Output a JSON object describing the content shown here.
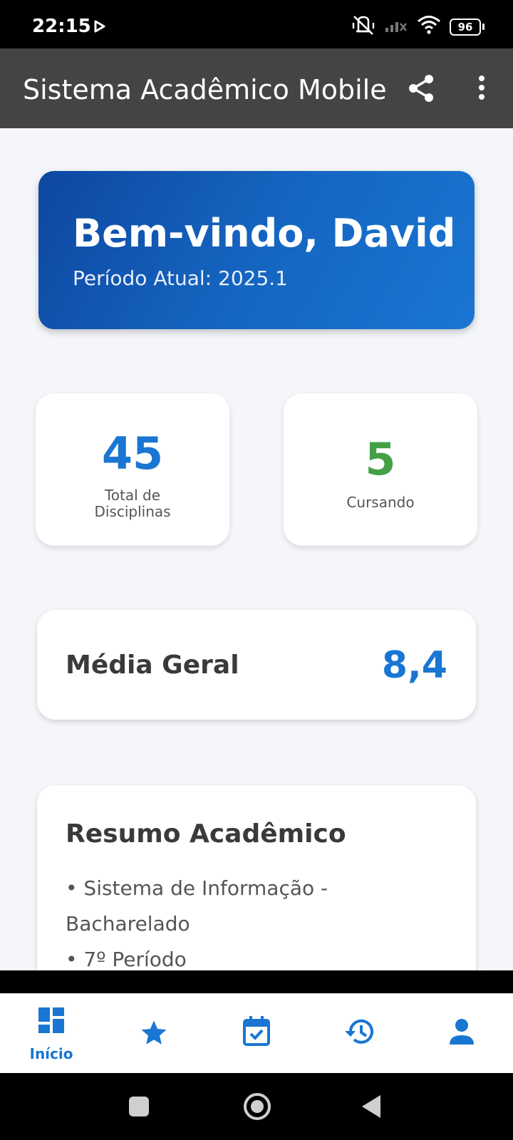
{
  "status": {
    "time": "22:15",
    "battery": "96"
  },
  "appbar": {
    "title": "Sistema Acadêmico Mobile"
  },
  "welcome": {
    "title": "Bem-vindo, David",
    "period": "Período Atual: 2025.1"
  },
  "stats": [
    {
      "value": "45",
      "label_line1": "Total de",
      "label_line2": "Disciplinas",
      "color": "#1976d2"
    },
    {
      "value": "5",
      "label": "Cursando",
      "color": "#43a047"
    }
  ],
  "average": {
    "label": "Média Geral",
    "value": "8,4"
  },
  "summary": {
    "title": "Resumo Acadêmico",
    "items": [
      "• Sistema de Informação - Bacharelado",
      "• 7º Período"
    ]
  },
  "nav": {
    "items": [
      {
        "label": "Início",
        "icon": "dashboard-icon",
        "active": true
      },
      {
        "label": "",
        "icon": "star-icon"
      },
      {
        "label": "",
        "icon": "calendar-check-icon"
      },
      {
        "label": "",
        "icon": "history-icon"
      },
      {
        "label": "",
        "icon": "person-icon"
      }
    ],
    "accent": "#1976d2"
  }
}
